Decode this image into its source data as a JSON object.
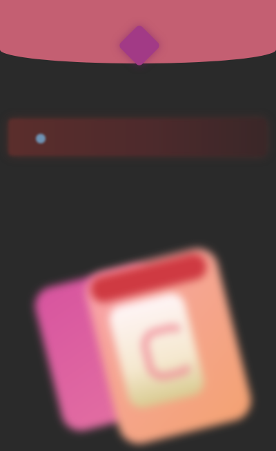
{
  "header": {
    "background_color": "#c45f72",
    "app_icon": "app-logo-icon",
    "app_caption": ""
  },
  "banner": {
    "text": "",
    "icon": "notification-dot-icon"
  },
  "main": {
    "headline": "",
    "subline": ""
  },
  "illustration": {
    "icon": "stacked-cards-illustration",
    "accent_colors": [
      "#d7549f",
      "#f9a0ae",
      "#f4a271",
      "#cf3a42"
    ]
  }
}
